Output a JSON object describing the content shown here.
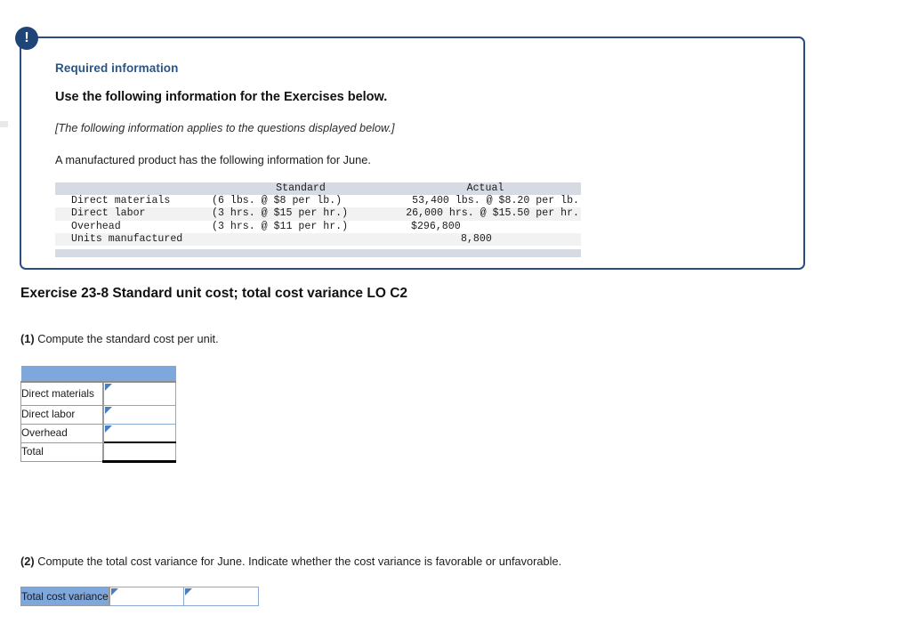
{
  "panel": {
    "alert_icon": "exclamation-icon",
    "required_label": "Required information",
    "subtitle": "Use the following information for the Exercises below.",
    "applies_note": "[The following information applies to the questions displayed below.]",
    "intro": "A manufactured product has the following information for June."
  },
  "data_table": {
    "headers": [
      "",
      "Standard",
      "Actual"
    ],
    "rows": [
      {
        "label": "Direct materials",
        "standard": "(6 lbs. @ $8 per lb.)",
        "actual": "53,400 lbs. @ $8.20 per lb."
      },
      {
        "label": "Direct labor",
        "standard": "(3 hrs. @ $15 per hr.)",
        "actual": "26,000 hrs. @ $15.50 per hr."
      },
      {
        "label": "Overhead",
        "standard": "(3 hrs. @ $11 per hr.)",
        "actual": "$296,800"
      },
      {
        "label": "Units manufactured",
        "standard": "",
        "actual": "8,800"
      }
    ]
  },
  "exercise": {
    "heading": "Exercise 23-8 Standard unit cost; total cost variance LO C2"
  },
  "question1": {
    "number": "(1)",
    "text": "Compute the standard cost per unit.",
    "table": {
      "header": "",
      "rows": [
        {
          "label": "Direct materials",
          "value": ""
        },
        {
          "label": "Direct labor",
          "value": ""
        },
        {
          "label": "Overhead",
          "value": ""
        },
        {
          "label": "Total",
          "value": ""
        }
      ]
    }
  },
  "question2": {
    "number": "(2)",
    "text": "Compute the total cost variance for June. Indicate whether the cost variance is favorable or unfavorable.",
    "table": {
      "label": "Total cost variance",
      "amount_value": "",
      "direction_value": ""
    }
  },
  "colors": {
    "panel_border": "#2a4d82",
    "badge": "#1f4578",
    "required_text": "#2a5585",
    "header_blue": "#7ea7dc",
    "data_header_gray": "#d6dae3",
    "marker_blue": "#4a7ec0"
  }
}
